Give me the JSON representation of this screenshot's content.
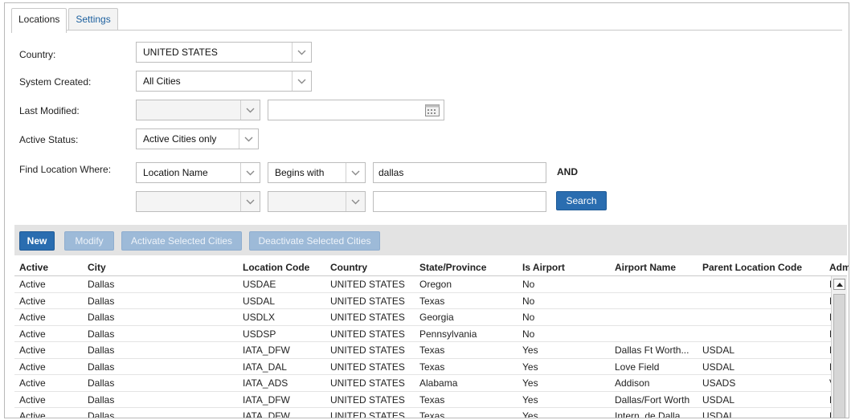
{
  "tabs": [
    {
      "label": "Locations",
      "active": true
    },
    {
      "label": "Settings",
      "active": false
    }
  ],
  "form": {
    "country": {
      "label": "Country:",
      "value": "UNITED STATES"
    },
    "system_created": {
      "label": "System Created:",
      "value": "All Cities"
    },
    "last_modified": {
      "label": "Last Modified:",
      "operator": "",
      "date": ""
    },
    "active_status": {
      "label": "Active Status:",
      "value": "Active Cities only"
    },
    "find": {
      "label": "Find Location Where:",
      "row1": {
        "field": "Location Name",
        "operator": "Begins with",
        "value": "dallas",
        "joiner": "AND"
      },
      "row2": {
        "field": "",
        "operator": "",
        "value": ""
      },
      "search_label": "Search"
    }
  },
  "toolbar": {
    "new_label": "New",
    "modify_label": "Modify",
    "activate_label": "Activate Selected Cities",
    "deactivate_label": "Deactivate Selected Cities"
  },
  "table": {
    "columns": [
      "Active",
      "City",
      "Location Code",
      "Country",
      "State/Province",
      "Is Airport",
      "Airport Name",
      "Parent Location Code",
      "Adm"
    ],
    "rows": [
      [
        "Active",
        "Dallas",
        "USDAE",
        "UNITED STATES",
        "Oregon",
        "No",
        "",
        "",
        "F"
      ],
      [
        "Active",
        "Dallas",
        "USDAL",
        "UNITED STATES",
        "Texas",
        "No",
        "",
        "",
        "D"
      ],
      [
        "Active",
        "Dallas",
        "USDLX",
        "UNITED STATES",
        "Georgia",
        "No",
        "",
        "",
        "F"
      ],
      [
        "Active",
        "Dallas",
        "USDSP",
        "UNITED STATES",
        "Pennsylvania",
        "No",
        "",
        "",
        "L"
      ],
      [
        "Active",
        "Dallas",
        "IATA_DFW",
        "UNITED STATES",
        "Texas",
        "Yes",
        "Dallas Ft Worth...",
        "USDAL",
        "D"
      ],
      [
        "Active",
        "Dallas",
        "IATA_DAL",
        "UNITED STATES",
        "Texas",
        "Yes",
        "Love Field",
        "USDAL",
        "D"
      ],
      [
        "Active",
        "Dallas",
        "IATA_ADS",
        "UNITED STATES",
        "Alabama",
        "Yes",
        "Addison",
        "USADS",
        "V"
      ],
      [
        "Active",
        "Dallas",
        "IATA_DFW",
        "UNITED STATES",
        "Texas",
        "Yes",
        "Dallas/Fort Worth",
        "USDAL",
        "D"
      ],
      [
        "Active",
        "Dallas",
        "IATA_DFW",
        "UNITED STATES",
        "Texas",
        "Yes",
        "Intern. de Dalla...",
        "USDAL",
        "D"
      ]
    ]
  },
  "colors": {
    "primary": "#2a6db0",
    "primary_disabled": "#9dbad8",
    "toolbar_bg": "#e3e3e3"
  }
}
